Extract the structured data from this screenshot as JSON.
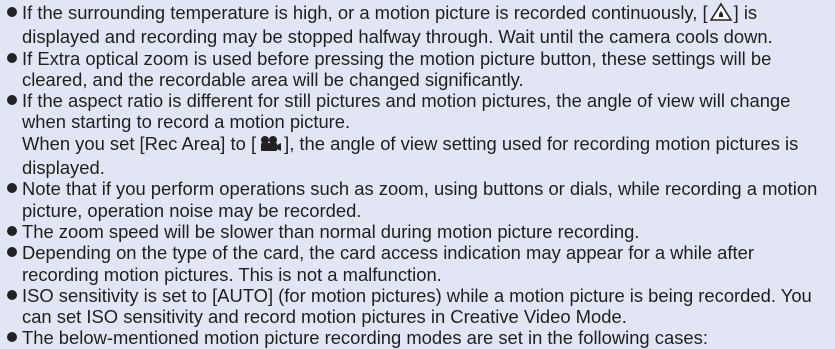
{
  "notes": [
    {
      "lines": [
        "If the surrounding temperature is high, or a motion picture is recorded continuously, [",
        "] is displayed and recording may be stopped halfway through. Wait until the camera cools down."
      ],
      "icon": "overheat-warning-icon"
    },
    {
      "text": "If Extra optical zoom is used before pressing the motion picture button, these settings will be cleared, and the recordable area will be changed significantly."
    },
    {
      "text": "If the aspect ratio is different for still pictures and motion pictures, the angle of view will change when starting to record a motion picture.",
      "text2a": "When you set [Rec Area] to [",
      "text2b": "], the angle of view setting used for recording motion pictures is displayed.",
      "icon": "motion-picture-camera-icon"
    },
    {
      "text": "Note that if you perform operations such as zoom, using buttons or dials, while recording a motion picture, operation noise may be recorded."
    },
    {
      "text": "The zoom speed will be slower than normal during motion picture recording."
    },
    {
      "text": "Depending on the type of the card, the card access indication may appear for a while after recording motion pictures. This is not a malfunction."
    },
    {
      "text": "ISO sensitivity is set to [AUTO] (for motion pictures) while a motion picture is being recorded. You can set ISO sensitivity and record motion pictures in Creative Video Mode."
    },
    {
      "text": "The below-mentioned motion picture recording modes are set in the following cases:"
    }
  ],
  "colors": {
    "background": "#e2e6f4",
    "text": "#1f1f1f",
    "bullet": "#222222"
  }
}
